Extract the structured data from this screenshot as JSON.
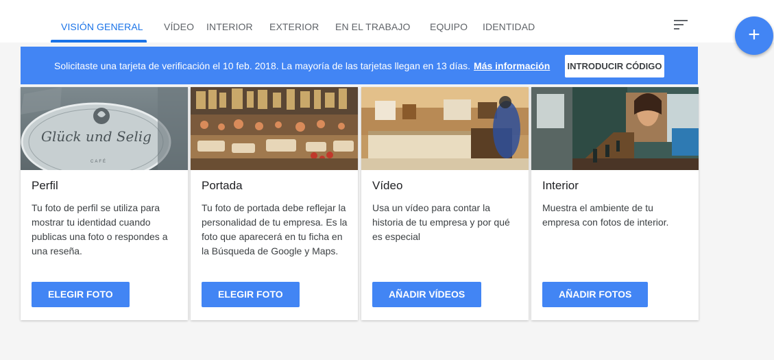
{
  "tabs": [
    {
      "label": "VISIÓN GENERAL",
      "active": true
    },
    {
      "label": "VÍDEO"
    },
    {
      "label": "INTERIOR"
    },
    {
      "label": "EXTERIOR"
    },
    {
      "label": "EN EL TRABAJO"
    },
    {
      "label": "EQUIPO"
    },
    {
      "label": "IDENTIDAD"
    }
  ],
  "icons": {
    "sort": "sort-icon",
    "add": "add-icon"
  },
  "fab": {
    "label": "+"
  },
  "notice": {
    "text": "Solicitaste una tarjeta de verificación el 10 feb. 2018. La mayoría de las tarjetas llegan en 13 días.",
    "link": "Más información",
    "button": "INTRODUCIR CÓDIGO"
  },
  "cards": [
    {
      "title": "Perfil",
      "description": "Tu foto de perfil se utiliza para mostrar tu identidad cuando publicas una foto o respondes a una reseña.",
      "button": "ELEGIR FOTO",
      "logo_text": "Glück und Selig",
      "logo_sub": "CAFÉ"
    },
    {
      "title": "Portada",
      "description": "Tu foto de portada debe reflejar la personalidad de tu empresa. Es la foto que aparecerá en tu ficha en la Búsqueda de Google y Maps.",
      "button": "ELEGIR FOTO"
    },
    {
      "title": "Vídeo",
      "description": "Usa un vídeo para contar la historia de tu empresa y por qué es especial",
      "button": "AÑADIR VÍDEOS"
    },
    {
      "title": "Interior",
      "description": "Muestra el ambiente de tu empresa con fotos de interior.",
      "button": "AÑADIR FOTOS"
    }
  ],
  "colors": {
    "accent": "#1a73e8",
    "banner": "#4285f4",
    "button": "#4285f4"
  }
}
